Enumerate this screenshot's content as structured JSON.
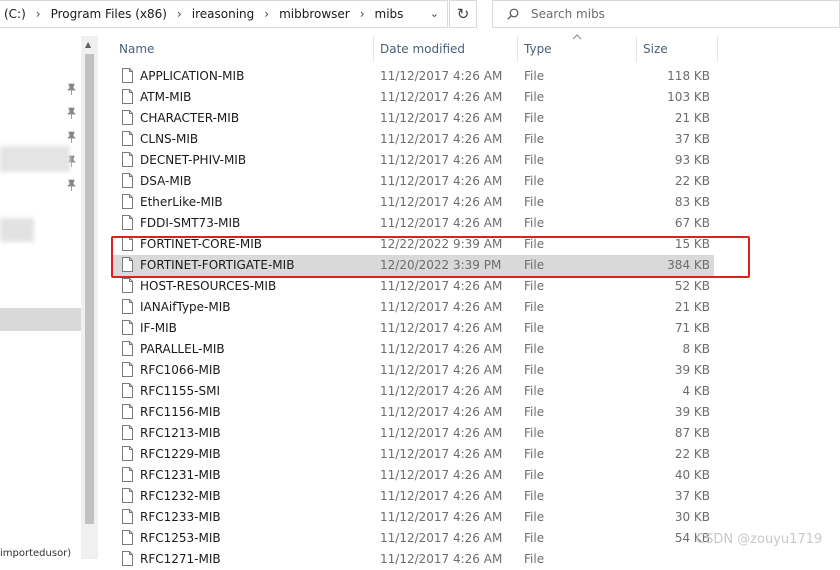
{
  "address_bar": {
    "crumbs": [
      "(C:)",
      "Program Files (x86)",
      "ireasoning",
      "mibbrowser",
      "mibs"
    ]
  },
  "search": {
    "placeholder": "Search mibs"
  },
  "columns": {
    "name": "Name",
    "date": "Date modified",
    "type": "Type",
    "size": "Size"
  },
  "nav_pane": {
    "partial_text": "importedusor)"
  },
  "files": [
    {
      "name": "APPLICATION-MIB",
      "date": "11/12/2017 4:26 AM",
      "type": "File",
      "size": "118 KB"
    },
    {
      "name": "ATM-MIB",
      "date": "11/12/2017 4:26 AM",
      "type": "File",
      "size": "103 KB"
    },
    {
      "name": "CHARACTER-MIB",
      "date": "11/12/2017 4:26 AM",
      "type": "File",
      "size": "21 KB"
    },
    {
      "name": "CLNS-MIB",
      "date": "11/12/2017 4:26 AM",
      "type": "File",
      "size": "37 KB"
    },
    {
      "name": "DECNET-PHIV-MIB",
      "date": "11/12/2017 4:26 AM",
      "type": "File",
      "size": "93 KB"
    },
    {
      "name": "DSA-MIB",
      "date": "11/12/2017 4:26 AM",
      "type": "File",
      "size": "22 KB"
    },
    {
      "name": "EtherLike-MIB",
      "date": "11/12/2017 4:26 AM",
      "type": "File",
      "size": "83 KB"
    },
    {
      "name": "FDDI-SMT73-MIB",
      "date": "11/12/2017 4:26 AM",
      "type": "File",
      "size": "67 KB"
    },
    {
      "name": "FORTINET-CORE-MIB",
      "date": "12/22/2022 9:39 AM",
      "type": "File",
      "size": "15 KB"
    },
    {
      "name": "FORTINET-FORTIGATE-MIB",
      "date": "12/20/2022 3:39 PM",
      "type": "File",
      "size": "384 KB",
      "selected": true
    },
    {
      "name": "HOST-RESOURCES-MIB",
      "date": "11/12/2017 4:26 AM",
      "type": "File",
      "size": "52 KB"
    },
    {
      "name": "IANAifType-MIB",
      "date": "11/12/2017 4:26 AM",
      "type": "File",
      "size": "21 KB"
    },
    {
      "name": "IF-MIB",
      "date": "11/12/2017 4:26 AM",
      "type": "File",
      "size": "71 KB"
    },
    {
      "name": "PARALLEL-MIB",
      "date": "11/12/2017 4:26 AM",
      "type": "File",
      "size": "8 KB"
    },
    {
      "name": "RFC1066-MIB",
      "date": "11/12/2017 4:26 AM",
      "type": "File",
      "size": "39 KB"
    },
    {
      "name": "RFC1155-SMI",
      "date": "11/12/2017 4:26 AM",
      "type": "File",
      "size": "4 KB"
    },
    {
      "name": "RFC1156-MIB",
      "date": "11/12/2017 4:26 AM",
      "type": "File",
      "size": "39 KB"
    },
    {
      "name": "RFC1213-MIB",
      "date": "11/12/2017 4:26 AM",
      "type": "File",
      "size": "87 KB"
    },
    {
      "name": "RFC1229-MIB",
      "date": "11/12/2017 4:26 AM",
      "type": "File",
      "size": "22 KB"
    },
    {
      "name": "RFC1231-MIB",
      "date": "11/12/2017 4:26 AM",
      "type": "File",
      "size": "40 KB"
    },
    {
      "name": "RFC1232-MIB",
      "date": "11/12/2017 4:26 AM",
      "type": "File",
      "size": "37 KB"
    },
    {
      "name": "RFC1233-MIB",
      "date": "11/12/2017 4:26 AM",
      "type": "File",
      "size": "30 KB"
    },
    {
      "name": "RFC1253-MIB",
      "date": "11/12/2017 4:26 AM",
      "type": "File",
      "size": "54 KB"
    },
    {
      "name": "RFC1271-MIB",
      "date": "11/12/2017 4:26 AM",
      "type": "File",
      "size": ""
    }
  ],
  "watermark": "CSDN @zouyu1719",
  "colors": {
    "highlight_box": "#e02020",
    "selected_row": "#d9d9d9",
    "header_text": "#4c607a"
  }
}
